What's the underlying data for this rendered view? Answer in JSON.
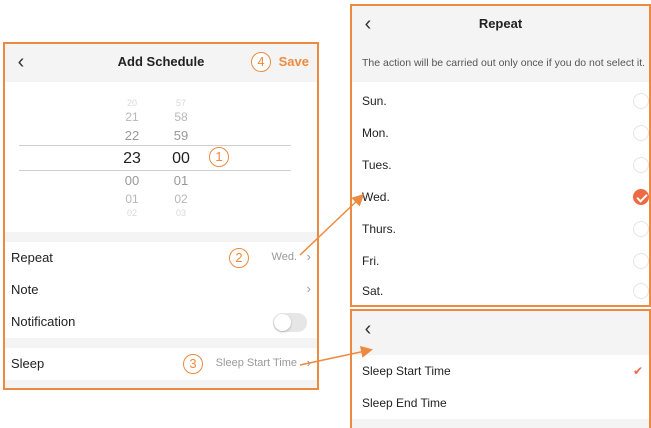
{
  "add_schedule": {
    "title": "Add Schedule",
    "back_icon": "chevron-left-icon",
    "save_label": "Save",
    "markers": {
      "save": "4",
      "time": "1",
      "repeat": "2",
      "sleep": "3"
    },
    "picker": {
      "hours": [
        "20",
        "21",
        "22",
        "23",
        "00",
        "01",
        "02"
      ],
      "minutes": [
        "57",
        "58",
        "59",
        "00",
        "01",
        "02",
        "03"
      ],
      "selected_hour": "23",
      "selected_minute": "00"
    },
    "rows": {
      "repeat": {
        "label": "Repeat",
        "value": "Wed."
      },
      "note": {
        "label": "Note"
      },
      "notification": {
        "label": "Notification",
        "enabled": false
      },
      "sleep": {
        "label": "Sleep",
        "value": "Sleep Start Time"
      }
    }
  },
  "repeat_screen": {
    "title": "Repeat",
    "description": "The action will be carried out only once if you do not select it.",
    "days": [
      {
        "label": "Sun.",
        "selected": false
      },
      {
        "label": "Mon.",
        "selected": false
      },
      {
        "label": "Tues.",
        "selected": false
      },
      {
        "label": "Wed.",
        "selected": true
      },
      {
        "label": "Thurs.",
        "selected": false
      },
      {
        "label": "Fri.",
        "selected": false
      },
      {
        "label": "Sat.",
        "selected": false
      }
    ]
  },
  "sleep_screen": {
    "options": [
      {
        "label": "Sleep Start Time",
        "selected": true
      },
      {
        "label": "Sleep End Time",
        "selected": false
      }
    ]
  },
  "colors": {
    "accent": "#ee8a3f",
    "check": "#ee6a45",
    "separator": "#f4f4f4"
  }
}
